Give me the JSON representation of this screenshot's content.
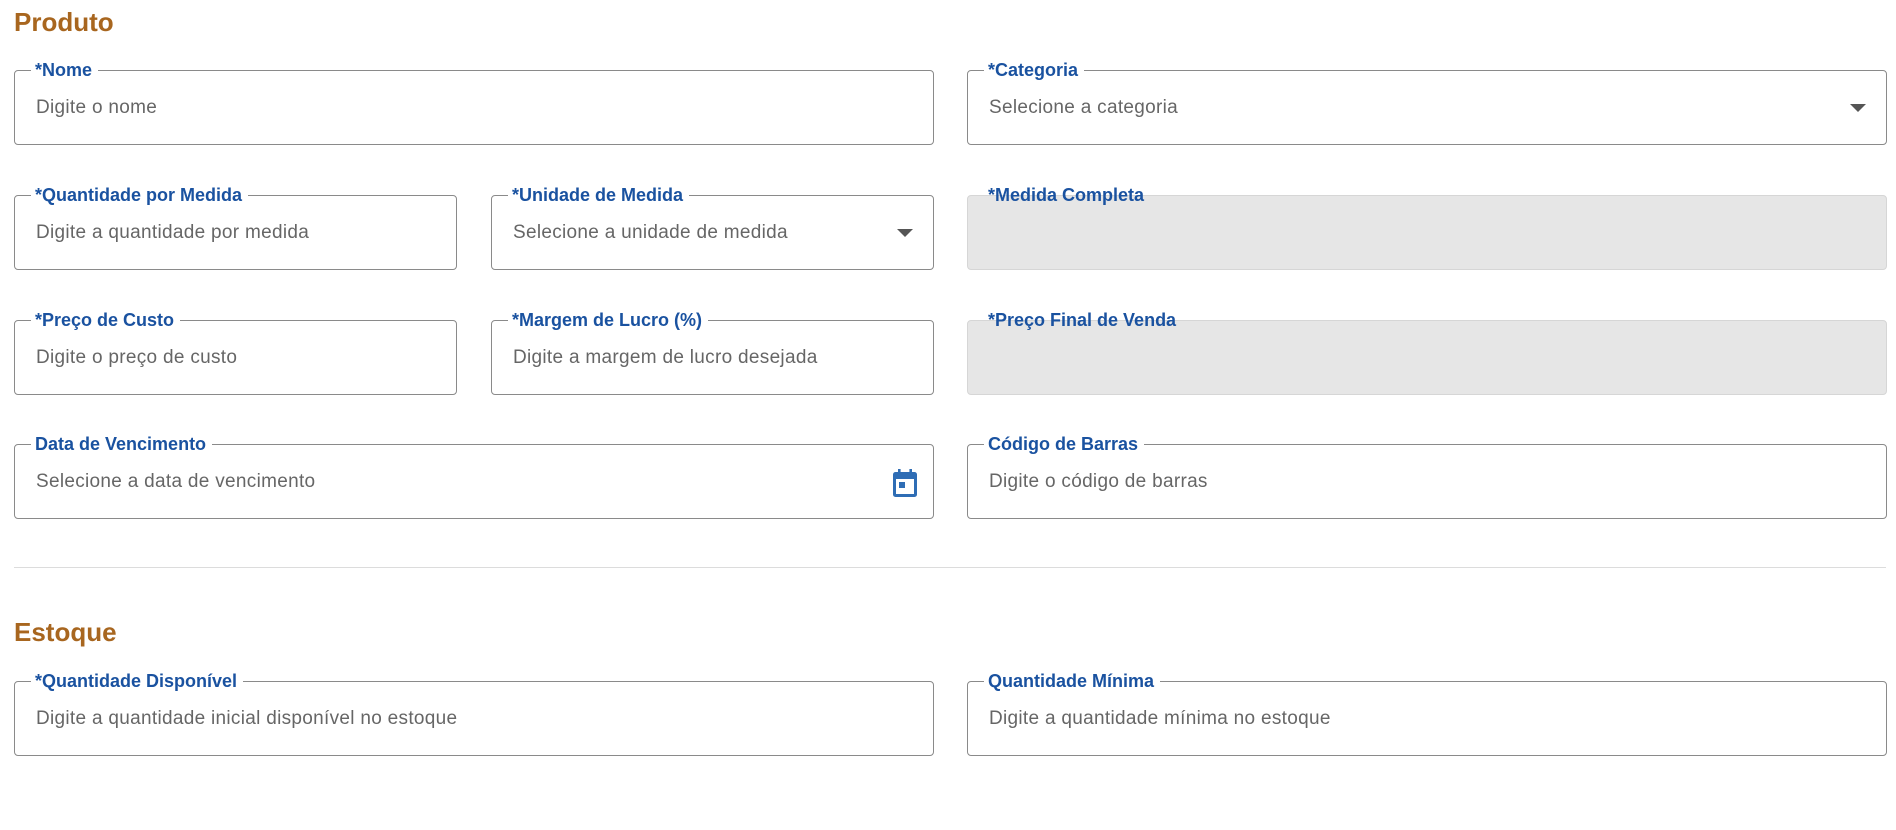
{
  "produto": {
    "title": "Produto",
    "nome": {
      "label": "*Nome",
      "placeholder": "Digite o nome"
    },
    "categoria": {
      "label": "*Categoria",
      "placeholder": "Selecione a categoria"
    },
    "quantidade_por_medida": {
      "label": "*Quantidade por Medida",
      "placeholder": "Digite a quantidade por medida"
    },
    "unidade_de_medida": {
      "label": "*Unidade de Medida",
      "placeholder": "Selecione a unidade de medida"
    },
    "medida_completa": {
      "label": "*Medida Completa"
    },
    "preco_de_custo": {
      "label": "*Preço de Custo",
      "placeholder": "Digite o preço de custo"
    },
    "margem_de_lucro": {
      "label": "*Margem de Lucro (%)",
      "placeholder": "Digite a margem de lucro desejada"
    },
    "preco_final_de_venda": {
      "label": "*Preço Final de Venda"
    },
    "data_de_vencimento": {
      "label": "Data de Vencimento",
      "placeholder": "Selecione a data de vencimento"
    },
    "codigo_de_barras": {
      "label": "Código de Barras",
      "placeholder": "Digite o código de barras"
    }
  },
  "estoque": {
    "title": "Estoque",
    "quantidade_disponivel": {
      "label": "*Quantidade Disponível",
      "placeholder": "Digite a quantidade inicial disponível no estoque"
    },
    "quantidade_minima": {
      "label": "Quantidade Mínima",
      "placeholder": "Digite a quantidade mínima no estoque"
    }
  },
  "icons": {
    "dropdown": "chevron-down-icon",
    "calendar": "calendar-icon"
  },
  "colors": {
    "section_title": "#A8661F",
    "label": "#1A52A0",
    "disabled_bg": "#E6E6E6",
    "icon": "#2F6DB5"
  }
}
